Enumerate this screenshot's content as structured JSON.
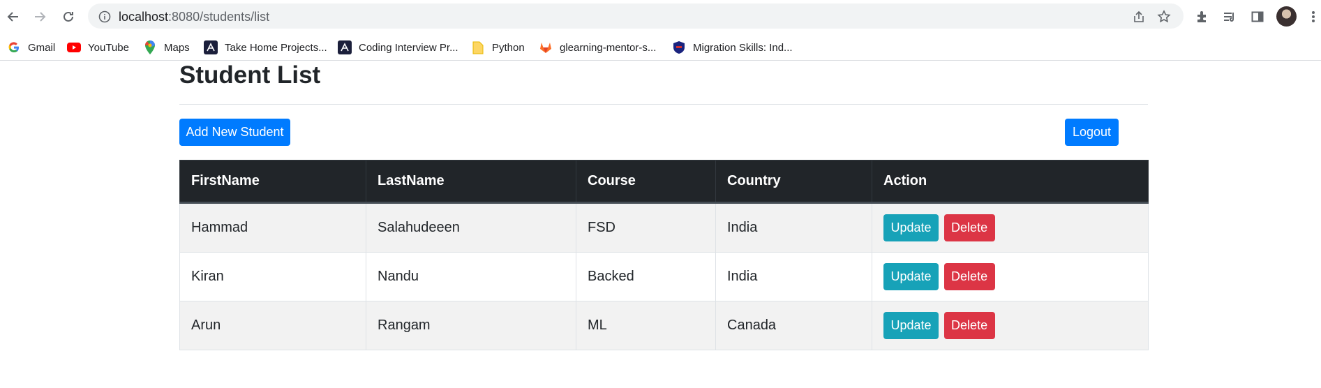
{
  "browser": {
    "url_host": "localhost",
    "url_path": ":8080/students/list",
    "bookmarks": [
      {
        "label": "Gmail",
        "icon": "google-icon"
      },
      {
        "label": "YouTube",
        "icon": "youtube-icon"
      },
      {
        "label": "Maps",
        "icon": "maps-icon"
      },
      {
        "label": "Take Home Projects...",
        "icon": "take-home-icon"
      },
      {
        "label": "Coding Interview Pr...",
        "icon": "coding-interview-icon"
      },
      {
        "label": "Python",
        "icon": "folder-icon"
      },
      {
        "label": "glearning-mentor-s...",
        "icon": "gitlab-icon"
      },
      {
        "label": "Migration Skills: Ind...",
        "icon": "shield-icon"
      }
    ]
  },
  "page": {
    "title": "Student List",
    "add_button": "Add New Student",
    "logout_button": "Logout"
  },
  "table": {
    "headers": [
      "FirstName",
      "LastName",
      "Course",
      "Country",
      "Action"
    ],
    "rows": [
      {
        "first": "Hammad",
        "last": "Salahudeeen",
        "course": "FSD",
        "country": "India"
      },
      {
        "first": "Kiran",
        "last": "Nandu",
        "course": "Backed",
        "country": "India"
      },
      {
        "first": "Arun",
        "last": "Rangam",
        "course": "ML",
        "country": "Canada"
      }
    ],
    "update_label": "Update",
    "delete_label": "Delete"
  },
  "colors": {
    "primary": "#007bff",
    "info": "#17a2b8",
    "danger": "#dc3545",
    "table_head": "#212529"
  }
}
